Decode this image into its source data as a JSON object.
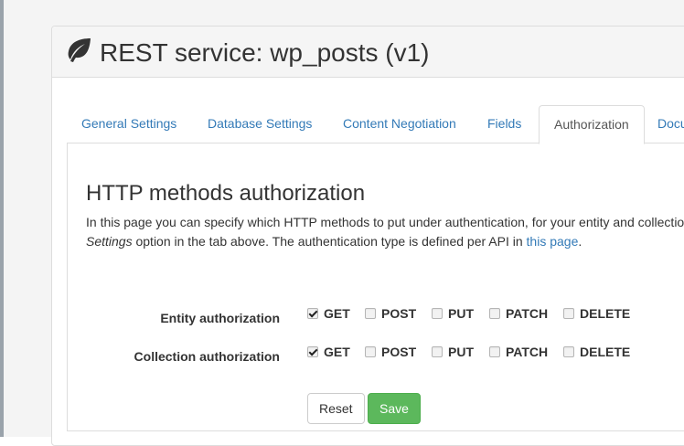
{
  "panel": {
    "title": "REST service: wp_posts (v1)",
    "icon": "leaf-icon"
  },
  "tabs": [
    {
      "label": "General Settings",
      "active": false
    },
    {
      "label": "Database Settings",
      "active": false
    },
    {
      "label": "Content Negotiation",
      "active": false
    },
    {
      "label": "Fields",
      "active": false
    },
    {
      "label": "Authorization",
      "active": true
    },
    {
      "label": "Docu",
      "active": false
    }
  ],
  "content": {
    "heading": "HTTP methods authorization",
    "desc_line1": "In this page you can specify which HTTP methods to put under authentication, for your entity and collectio",
    "desc_settings": "Settings",
    "desc_line2_mid": " option in the tab above. The authentication type is defined per API in ",
    "desc_link": "this page",
    "desc_end": "."
  },
  "rows": [
    {
      "label": "Entity authorization",
      "methods": [
        {
          "label": "GET",
          "checked": true
        },
        {
          "label": "POST",
          "checked": false
        },
        {
          "label": "PUT",
          "checked": false
        },
        {
          "label": "PATCH",
          "checked": false
        },
        {
          "label": "DELETE",
          "checked": false
        }
      ]
    },
    {
      "label": "Collection authorization",
      "methods": [
        {
          "label": "GET",
          "checked": true
        },
        {
          "label": "POST",
          "checked": false
        },
        {
          "label": "PUT",
          "checked": false
        },
        {
          "label": "PATCH",
          "checked": false
        },
        {
          "label": "DELETE",
          "checked": false
        }
      ]
    }
  ],
  "buttons": {
    "reset": "Reset",
    "save": "Save"
  },
  "colors": {
    "link": "#337ab7",
    "save": "#5cb85c"
  }
}
